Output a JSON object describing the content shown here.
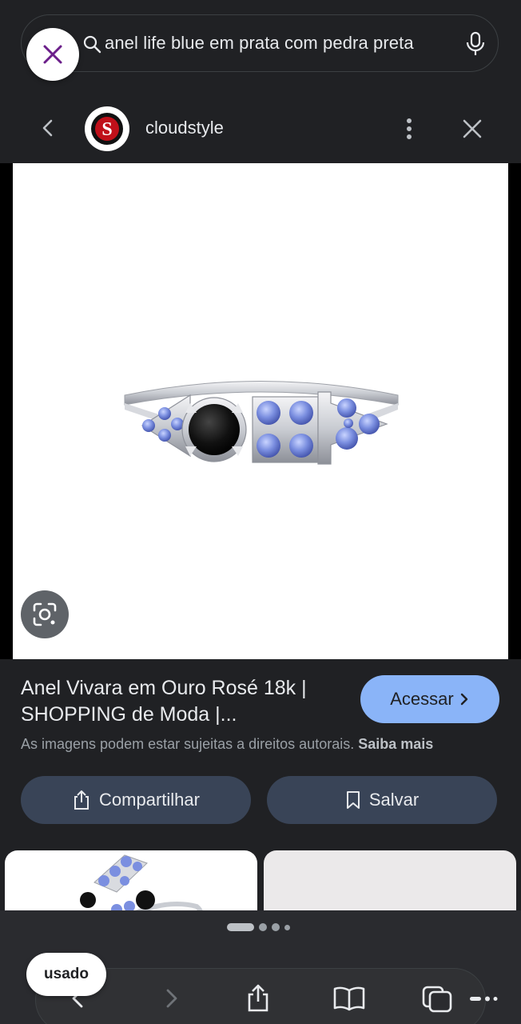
{
  "search": {
    "query": "anel life blue em prata com pedra preta"
  },
  "source": {
    "name": "cloudstyle",
    "logo_letter": "S"
  },
  "result": {
    "title_line1": "Anel Vivara em Ouro Rosé 18k |",
    "title_line2": "SHOPPING de Moda |...",
    "visit_label": "Acessar",
    "copyright_text": "As imagens podem estar sujeitas a direitos autorais.",
    "learn_more": "Saiba mais"
  },
  "actions": {
    "share_label": "Compartilhar",
    "save_label": "Salvar"
  },
  "bottom": {
    "chip_label": "usado"
  },
  "icons": {
    "search": "search-icon",
    "mic": "mic-icon",
    "close": "close-icon",
    "back": "back-arrow-icon",
    "more": "more-vertical-icon",
    "lens": "lens-icon",
    "share": "share-icon",
    "bookmark": "bookmark-icon",
    "chevron": "chevron-right-icon",
    "forward": "forward-arrow-icon",
    "book": "book-icon",
    "tabs": "tabs-icon"
  },
  "colors": {
    "background": "#202124",
    "accent_button": "#8ab4f8",
    "action_button": "#394457",
    "close_x": "#6b1f8a",
    "gem_blue": "#7b8fe0",
    "gem_black": "#111111"
  }
}
